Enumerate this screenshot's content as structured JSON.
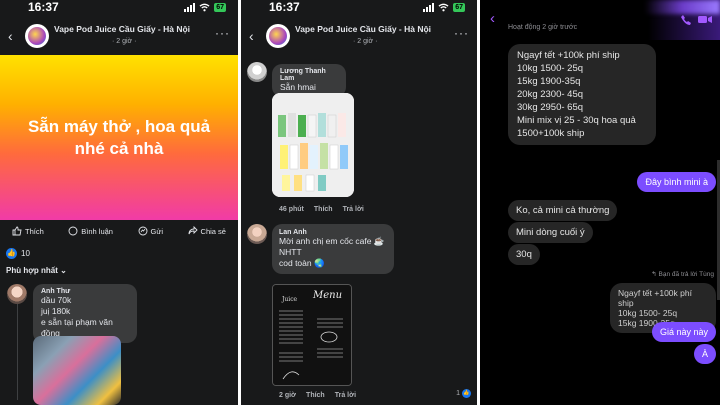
{
  "colors": {
    "fb_bg": "#18191a",
    "bubble": "#3a3b3c",
    "messenger_purple": "#7c4dff",
    "like_blue": "#1877f2"
  },
  "panel1": {
    "status": {
      "time": "16:37",
      "battery": "67"
    },
    "header": {
      "title": "Vape Pod Juice Cầu Giấy - Hà Nội",
      "sub": "· 2 giờ · ",
      "more": "···"
    },
    "banner": {
      "line1": "Sẵn máy thở , hoa quả",
      "line2": "nhé cả nhà"
    },
    "actions": {
      "like": "Thích",
      "comment": "Bình luận",
      "send": "Gửi",
      "share": "Chia sẻ"
    },
    "reactions": {
      "count": "10"
    },
    "sort_label": "Phù hợp nhất ⌄",
    "comment": {
      "name": "Anh Thư",
      "lines": [
        "dầu 70k",
        "juị 180k",
        "e sẵn tại phạm văn đồng"
      ]
    }
  },
  "panel2": {
    "status": {
      "time": "16:37",
      "battery": "67"
    },
    "header": {
      "title": "Vape Pod Juice Cầu Giấy - Hà Nội",
      "sub": "· 2 giờ · ",
      "more": "···"
    },
    "comment1": {
      "name": "Lương Thanh Lam",
      "text": "Sẵn hmai",
      "meta": [
        "46 phút",
        "Thích",
        "Trả lời"
      ]
    },
    "comment2": {
      "name": "Lan Anh",
      "lines": [
        "Mời anh chị em cốc cafe ☕",
        "NHTT",
        "cod toàn 🌏"
      ],
      "meta": [
        "2 giờ",
        "Thích",
        "Trả lời"
      ],
      "like_count": "1"
    },
    "menu_card": {
      "title": "Menu",
      "juice": "Juice"
    }
  },
  "panel3": {
    "header": {
      "activity": "Hoạt động 2 giờ trước"
    },
    "incoming1": [
      "Ngayf tết +100k phí ship",
      "10kg 1500- 25q",
      "15kg 1900-35q",
      "20kg 2300- 45q",
      "30kg 2950- 65q",
      "Mini mix vị 25 - 30q hoa quả",
      "1500+100k ship"
    ],
    "outgoing1": "Đây bình mini à",
    "incoming2": "Ko, cả mini cả thường",
    "incoming3": "Mini dòng cuối ý",
    "incoming4": "30q",
    "reply_note": "↰ Bạn đã trả lời Tùng",
    "quote_lines": [
      "Ngayf tết +100k phí ship",
      "10kg 1500- 25q",
      "15kg 1900-35q ..."
    ],
    "outgoing2": "Giá này này",
    "outgoing3": "À"
  }
}
